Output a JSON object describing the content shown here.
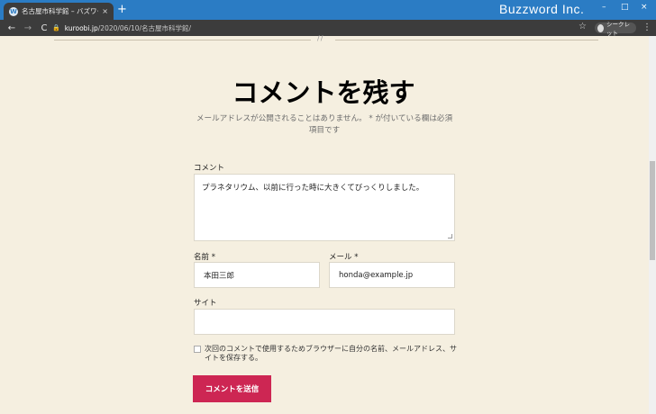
{
  "browser": {
    "tab_title": "名古屋市科学館 – バズワード出かけ…",
    "tab_close": "×",
    "new_tab": "+",
    "brand": "Buzzword Inc.",
    "window_controls": {
      "minimize": "–",
      "maximize": "□",
      "close": "×"
    },
    "nav": {
      "back": "←",
      "forward": "→",
      "reload": "C"
    },
    "url_host": "kuroobi.jp",
    "url_path": "/2020/06/10/名古屋市科学館/",
    "star": "☆",
    "profile_label": "シークレット",
    "menu": "⋮"
  },
  "page": {
    "separator_mark": "//",
    "heading": "コメントを残す",
    "notes": "メールアドレスが公開されることはありません。 * が付いている欄は必須項目です",
    "comment_label": "コメント",
    "comment_value": "プラネタリウム、以前に行った時に大きくてびっくりしました。",
    "name_label": "名前 *",
    "name_value": "本田三郎",
    "email_label": "メール *",
    "email_value": "honda@example.jp",
    "site_label": "サイト",
    "site_value": "",
    "save_info": "次回のコメントで使用するためブラウザーに自分の名前、メールアドレス、サイトを保存する。",
    "submit": "コメントを送信"
  },
  "colors": {
    "page_bg": "#f5efe0",
    "accent": "#cd2653",
    "titlebar": "#2b7cc4"
  }
}
